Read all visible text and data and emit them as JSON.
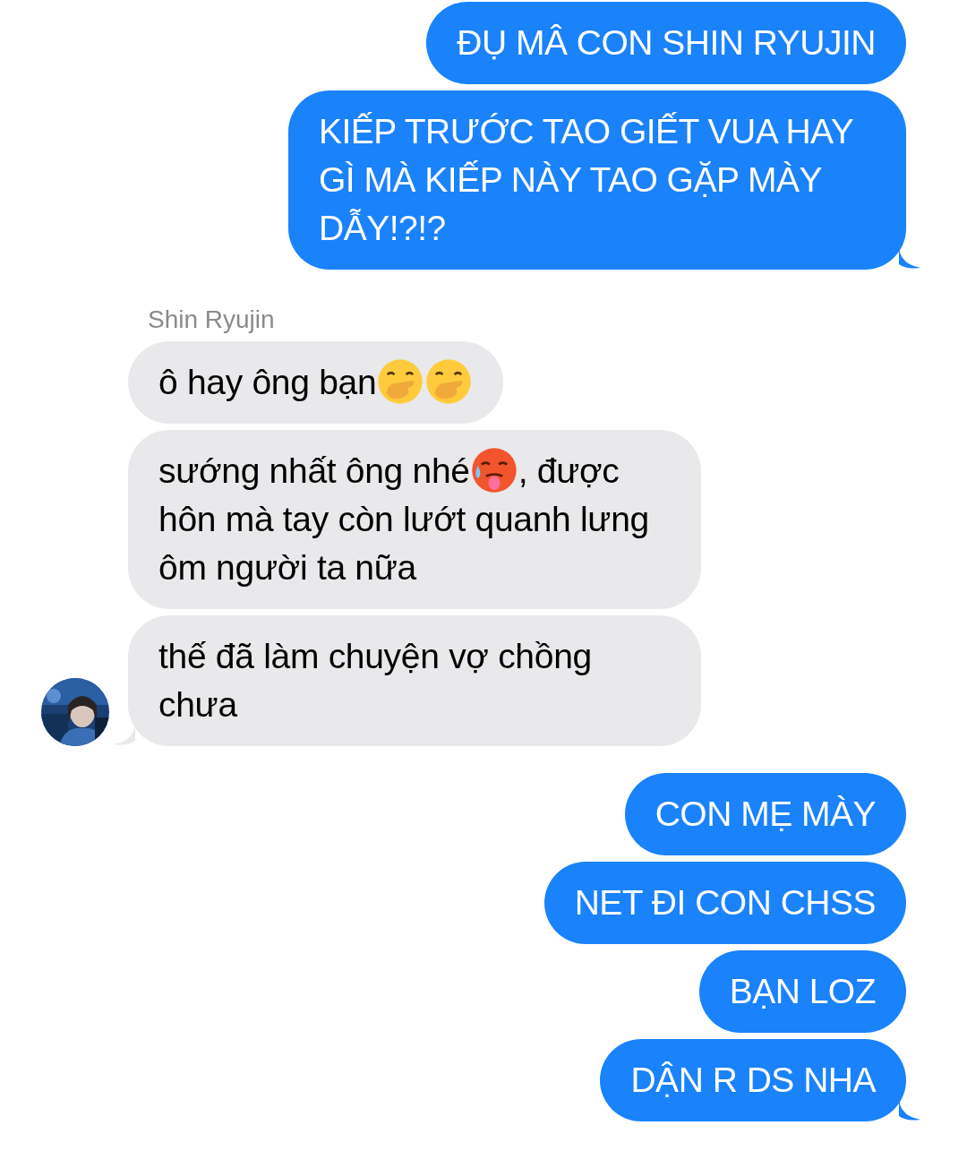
{
  "messages": [
    {
      "kind": "sent",
      "tail": false,
      "parts": [
        {
          "kind": "text",
          "text": "ĐỤ MÂ CON SHIN RYUJIN"
        }
      ]
    },
    {
      "kind": "sent",
      "tail": true,
      "parts": [
        {
          "kind": "block",
          "text": "KIẾP TRƯỚC TAO GIẾT VUA HAY GÌ MÀ KIẾP NÀY TAO GẶP MÀY DẪY!?!?"
        }
      ]
    },
    {
      "kind": "received",
      "tail": false,
      "sender": "Shin Ryujin",
      "parts": [
        {
          "kind": "text",
          "text": "ô hay ông bạn"
        },
        {
          "kind": "handmouth"
        },
        {
          "kind": "handmouth"
        }
      ]
    },
    {
      "kind": "received",
      "tail": false,
      "parts": [
        {
          "kind": "text",
          "text": "sướng nhất ông nhé"
        },
        {
          "kind": "hotface"
        },
        {
          "kind": "text",
          "text": ", được"
        },
        {
          "kind": "block",
          "text": "hôn mà tay còn lướt quanh lưng ôm người ta nữa"
        }
      ]
    },
    {
      "kind": "received",
      "tail": true,
      "parts": [
        {
          "kind": "block",
          "text": "thế đã làm chuyện vợ chồng chưa"
        }
      ]
    },
    {
      "kind": "sent",
      "tail": false,
      "parts": [
        {
          "kind": "text",
          "text": "CON MẸ MÀY"
        }
      ]
    },
    {
      "kind": "sent",
      "tail": false,
      "parts": [
        {
          "kind": "text",
          "text": "NET ĐI CON CHSS"
        }
      ]
    },
    {
      "kind": "sent",
      "tail": false,
      "parts": [
        {
          "kind": "text",
          "text": "BẠN LOZ"
        }
      ]
    },
    {
      "kind": "sent",
      "tail": true,
      "parts": [
        {
          "kind": "text",
          "text": "DẬN R DS NHA"
        }
      ]
    }
  ]
}
